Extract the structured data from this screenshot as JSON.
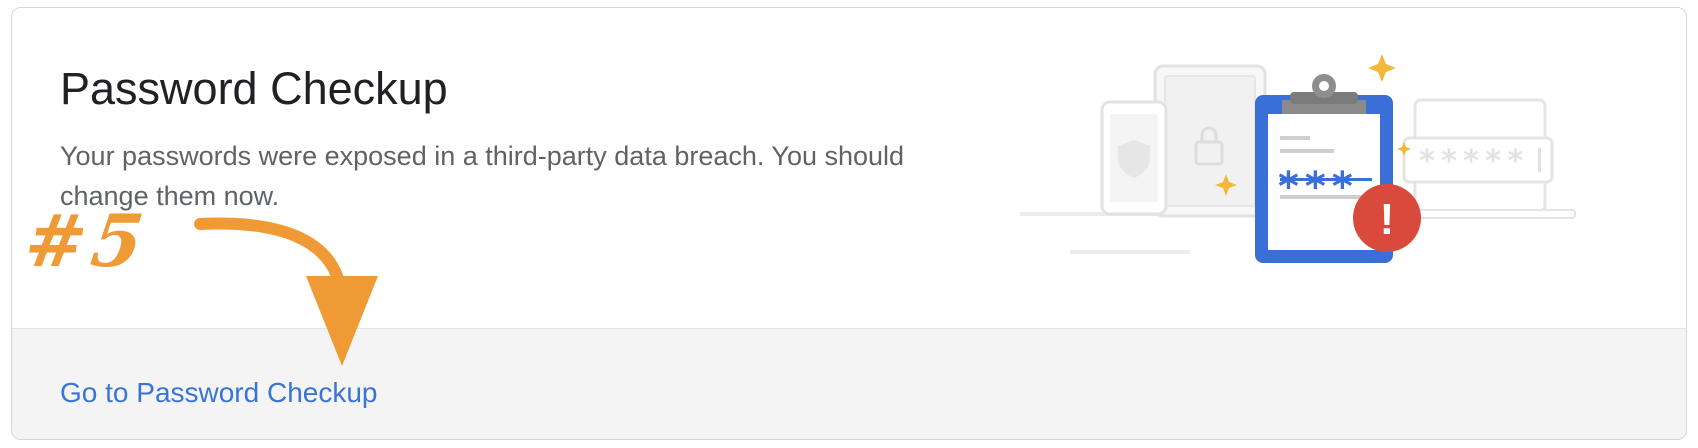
{
  "card": {
    "title": "Password Checkup",
    "description": "Your passwords were exposed in a third-party data breach. You should change them now.",
    "link_label": "Go to Password Checkup"
  },
  "illustration": {
    "masked_password": "*****",
    "clipboard_stars": "***",
    "alert_symbol": "!"
  },
  "annotation": {
    "label": "#5"
  },
  "colors": {
    "accent_blue": "#3a74d6",
    "alert_red": "#d94a3c",
    "sparkle_yellow": "#f3b83a",
    "annotation_orange": "#f09a36"
  }
}
